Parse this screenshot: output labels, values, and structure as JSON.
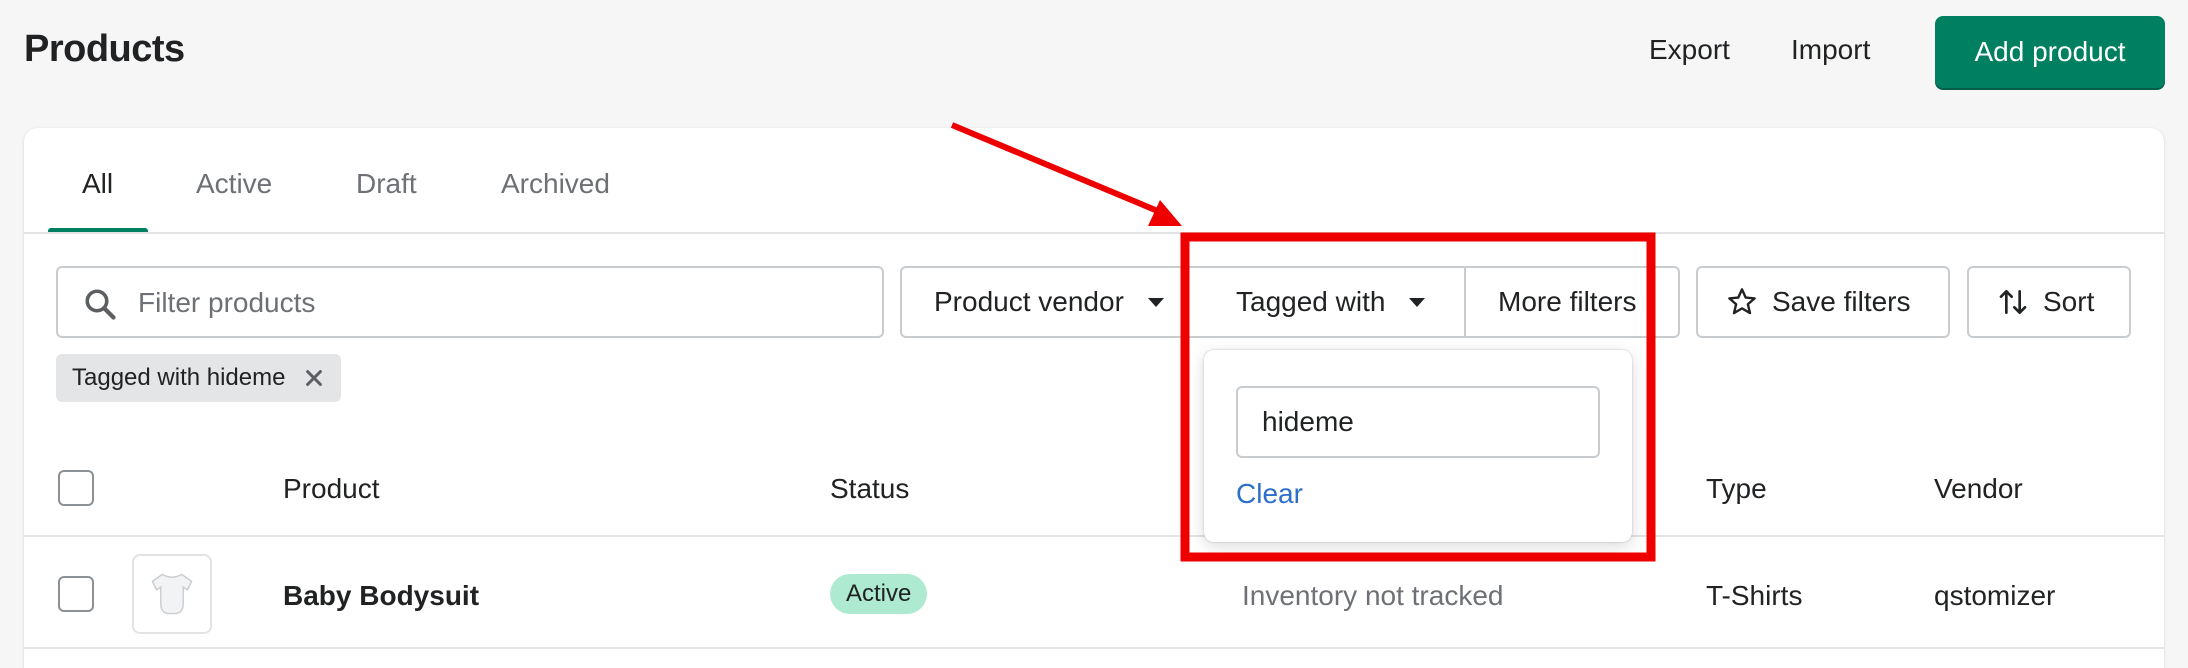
{
  "header": {
    "title": "Products",
    "export_label": "Export",
    "import_label": "Import",
    "add_label": "Add product"
  },
  "tabs": [
    {
      "label": "All",
      "active": true
    },
    {
      "label": "Active",
      "active": false
    },
    {
      "label": "Draft",
      "active": false
    },
    {
      "label": "Archived",
      "active": false
    }
  ],
  "filters": {
    "search_placeholder": "Filter products",
    "search_value": "",
    "vendor_label": "Product vendor",
    "tagged_label": "Tagged with",
    "more_label": "More filters",
    "save_label": "Save filters",
    "sort_label": "Sort"
  },
  "applied_filter": {
    "label": "Tagged with hideme"
  },
  "tag_popover": {
    "value": "hideme",
    "clear_label": "Clear"
  },
  "table": {
    "columns": [
      "Product",
      "Status",
      "Type",
      "Vendor"
    ],
    "rows": [
      {
        "product": "Baby Bodysuit",
        "status": "Active",
        "inventory": "Inventory not tracked",
        "type": "T-Shirts",
        "vendor": "qstomizer"
      }
    ]
  },
  "colors": {
    "primary": "#008060",
    "annotation": "#ee0000",
    "link": "#2c6ecb",
    "status_active_bg": "#aee9d1"
  },
  "icons": {
    "search": "search-icon",
    "caret": "caret-down-icon",
    "star": "star-icon",
    "sort": "sort-arrows-icon",
    "close": "close-icon"
  }
}
